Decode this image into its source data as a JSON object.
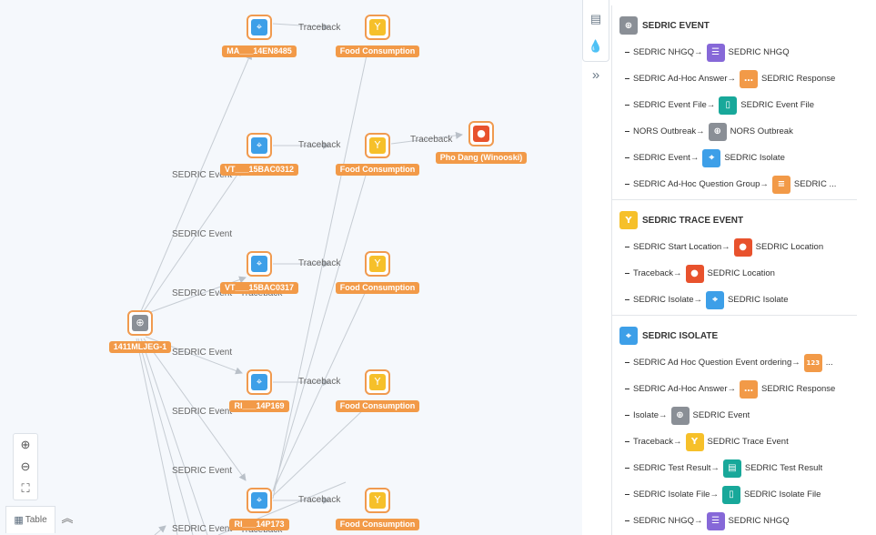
{
  "graph": {
    "nodes": [
      {
        "id": "n1",
        "label": "MA___14EN8485",
        "icon": "crosshair-icon",
        "color": "#3d9fe8"
      },
      {
        "id": "n2",
        "label": "Food Consumption",
        "icon": "fork-icon",
        "color": "#f6c02a"
      },
      {
        "id": "n3",
        "label": "VT___15BAC0312",
        "icon": "crosshair-icon",
        "color": "#3d9fe8"
      },
      {
        "id": "n4",
        "label": "Food Consumption",
        "icon": "fork-icon",
        "color": "#f6c02a"
      },
      {
        "id": "n5",
        "label": "Pho Dang (Winooski)",
        "icon": "location-pin-icon",
        "color": "#e8522d"
      },
      {
        "id": "n6",
        "label": "VT___15BAC0317",
        "icon": "crosshair-icon",
        "color": "#3d9fe8"
      },
      {
        "id": "n7",
        "label": "Food Consumption",
        "icon": "fork-icon",
        "color": "#f6c02a"
      },
      {
        "id": "n8",
        "label": "1411MLJEG-1",
        "icon": "globe-icon",
        "color": "#8a8f96"
      },
      {
        "id": "n9",
        "label": "RI___14P169",
        "icon": "crosshair-icon",
        "color": "#3d9fe8"
      },
      {
        "id": "n10",
        "label": "Food Consumption",
        "icon": "fork-icon",
        "color": "#f6c02a"
      },
      {
        "id": "n11",
        "label": "RI___14P173",
        "icon": "crosshair-icon",
        "color": "#3d9fe8"
      },
      {
        "id": "n12",
        "label": "Food Consumption",
        "icon": "fork-icon",
        "color": "#f6c02a"
      }
    ],
    "edge_labels": [
      "Traceback",
      "Traceback",
      "Traceback",
      "Traceback",
      "Traceback",
      "Traceback",
      "Traceback",
      "Traceback",
      "SEDRIC Event",
      "SEDRIC Event",
      "SEDRIC Event",
      "SEDRIC Event",
      "SEDRIC Event",
      "SEDRIC Event",
      "SEDRIC Event"
    ]
  },
  "controls": {
    "table_label": "Table"
  },
  "legend": {
    "sections": [
      {
        "title": "SEDRIC EVENT",
        "icon": "globe-icon",
        "color": "#8a8f96",
        "rows": [
          {
            "from": "SEDRIC NHGQ",
            "to": "SEDRIC NHGQ",
            "icon": "checklist-icon",
            "color": "#8668d8"
          },
          {
            "from": "SEDRIC Ad-Hoc Answer",
            "to": "SEDRIC Response",
            "icon": "chat-icon",
            "color": "#f29a48"
          },
          {
            "from": "SEDRIC Event File",
            "to": "SEDRIC Event File",
            "icon": "file-icon",
            "color": "#18a89a"
          },
          {
            "from": "NORS Outbreak",
            "to": "NORS Outbreak",
            "icon": "globe-icon",
            "color": "#8a8f96"
          },
          {
            "from": "SEDRIC Event",
            "to": "SEDRIC Isolate",
            "icon": "crosshair-icon",
            "color": "#3d9fe8"
          },
          {
            "from": "SEDRIC Ad-Hoc Question Group",
            "to": "SEDRIC ...",
            "icon": "list-icon",
            "color": "#f29a48"
          }
        ]
      },
      {
        "title": "SEDRIC TRACE EVENT",
        "icon": "fork-icon",
        "color": "#f6c02a",
        "rows": [
          {
            "from": "SEDRIC Start Location",
            "to": "SEDRIC Location",
            "icon": "location-pin-icon",
            "color": "#e8522d"
          },
          {
            "from": "Traceback",
            "to": "SEDRIC Location",
            "icon": "location-pin-icon",
            "color": "#e8522d"
          },
          {
            "from": "SEDRIC Isolate",
            "to": "SEDRIC Isolate",
            "icon": "crosshair-icon",
            "color": "#3d9fe8"
          }
        ]
      },
      {
        "title": "SEDRIC ISOLATE",
        "icon": "crosshair-icon",
        "color": "#3d9fe8",
        "rows": [
          {
            "from": "SEDRIC Ad Hoc Question Event ordering",
            "to": "...",
            "icon": "number-icon",
            "color": "#f29a48",
            "glyph": "123"
          },
          {
            "from": "SEDRIC Ad-Hoc Answer",
            "to": "SEDRIC Response",
            "icon": "chat-icon",
            "color": "#f29a48"
          },
          {
            "from": "Isolate",
            "to": "SEDRIC Event",
            "icon": "globe-icon",
            "color": "#8a8f96"
          },
          {
            "from": "Traceback",
            "to": "SEDRIC Trace Event",
            "icon": "fork-icon",
            "color": "#f6c02a"
          },
          {
            "from": "SEDRIC Test Result",
            "to": "SEDRIC Test Result",
            "icon": "table-icon",
            "color": "#18a89a"
          },
          {
            "from": "SEDRIC Isolate File",
            "to": "SEDRIC Isolate File",
            "icon": "file-icon",
            "color": "#18a89a"
          },
          {
            "from": "SEDRIC NHGQ",
            "to": "SEDRIC NHGQ",
            "icon": "checklist-icon",
            "color": "#8668d8"
          }
        ]
      }
    ]
  }
}
